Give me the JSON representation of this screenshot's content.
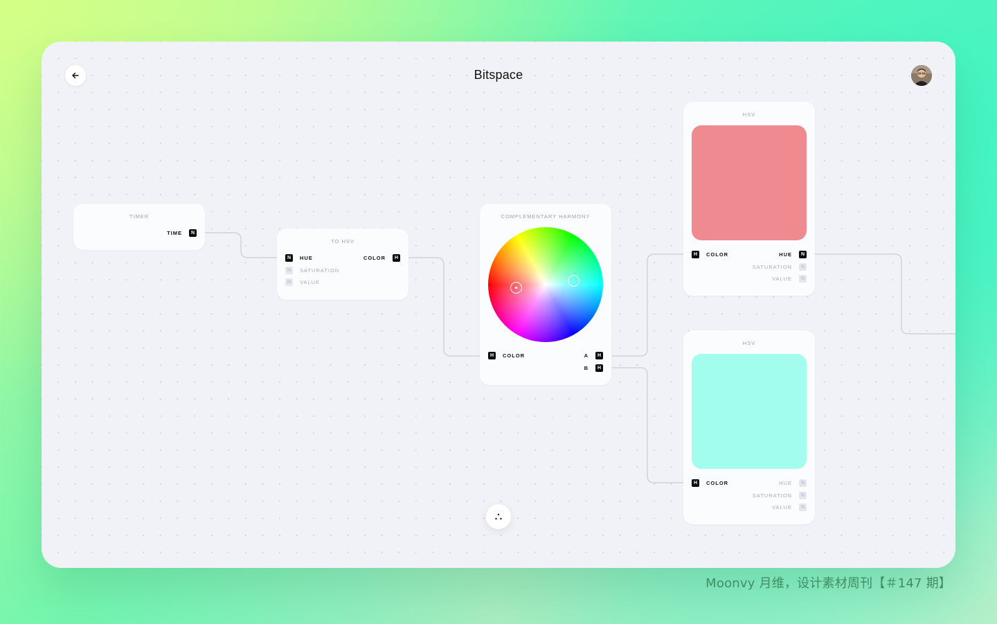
{
  "app": {
    "title": "Bitspace"
  },
  "nodes": {
    "timer": {
      "title": "TIMER",
      "out_label": "TIME",
      "out_type": "N"
    },
    "to_hsv": {
      "title": "TO HSV",
      "inputs": [
        {
          "label": "HUE",
          "type": "N",
          "active": true
        },
        {
          "label": "SATURATION",
          "type": "N",
          "active": false
        },
        {
          "label": "VALUE",
          "type": "N",
          "active": false
        }
      ],
      "output": {
        "label": "COLOR",
        "type": "H"
      }
    },
    "harmony": {
      "title": "COMPLEMENTARY HARMONY",
      "input": {
        "label": "COLOR",
        "type": "H"
      },
      "outputs": [
        {
          "label": "A",
          "type": "H"
        },
        {
          "label": "B",
          "type": "H"
        }
      ]
    },
    "hsv_top": {
      "title": "HSV",
      "color": "#ef8a91",
      "input": {
        "label": "COLOR",
        "type": "H"
      },
      "outputs": [
        {
          "label": "HUE",
          "type": "N",
          "active": true
        },
        {
          "label": "SATURATION",
          "type": "N",
          "active": false
        },
        {
          "label": "VALUE",
          "type": "N",
          "active": false
        }
      ]
    },
    "hsv_bottom": {
      "title": "HSV",
      "color": "#a2fdee",
      "input": {
        "label": "COLOR",
        "type": "H"
      },
      "outputs": [
        {
          "label": "HUE",
          "type": "N",
          "active": false
        },
        {
          "label": "SATURATION",
          "type": "N",
          "active": false
        },
        {
          "label": "VALUE",
          "type": "N",
          "active": false
        }
      ]
    }
  },
  "watermark": "Moonvy 月维，设计素材周刊【＃147 期】",
  "icons": {
    "back": "arrow-left-icon",
    "fab": "dots-icon",
    "avatar": "user-avatar"
  }
}
